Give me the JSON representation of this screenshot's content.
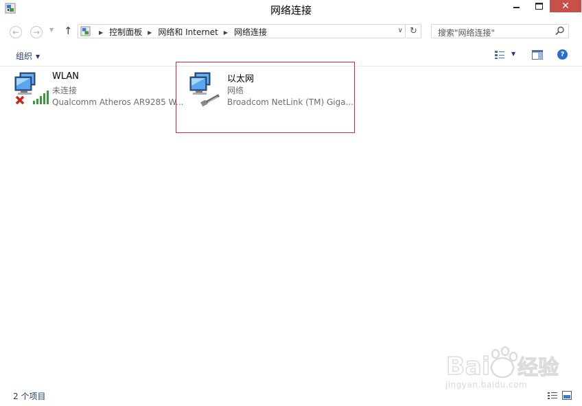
{
  "window": {
    "title": "网络连接",
    "controls": {
      "minimize": "—",
      "maximize": "□",
      "close": "✕"
    }
  },
  "navigation": {
    "back_glyph": "←",
    "forward_glyph": "→",
    "recent_glyph": "▼",
    "up_glyph": "↑",
    "breadcrumb": [
      "控制面板",
      "网络和 Internet",
      "网络连接"
    ],
    "separator_glyph": "▶",
    "dropdown_glyph": "∨",
    "refresh_glyph": "↻"
  },
  "search": {
    "placeholder": "搜索\"网络连接\""
  },
  "toolbar": {
    "organize_label": "组织",
    "caret_glyph": "▼",
    "help_glyph": "?"
  },
  "connections": [
    {
      "name": "WLAN",
      "status": "未连接",
      "device": "Qualcomm Atheros AR9285 W...",
      "icon": "wireless-network-disconnected-icon"
    },
    {
      "name": "以太网",
      "status": "网络",
      "device": "Broadcom NetLink (TM) Giga...",
      "icon": "ethernet-network-icon",
      "highlighted": true
    }
  ],
  "statusbar": {
    "item_count": "2 个项目"
  },
  "colors": {
    "highlight_border": "#d22630",
    "close_button": "#c7504b",
    "link_text": "#1e3c6e"
  }
}
